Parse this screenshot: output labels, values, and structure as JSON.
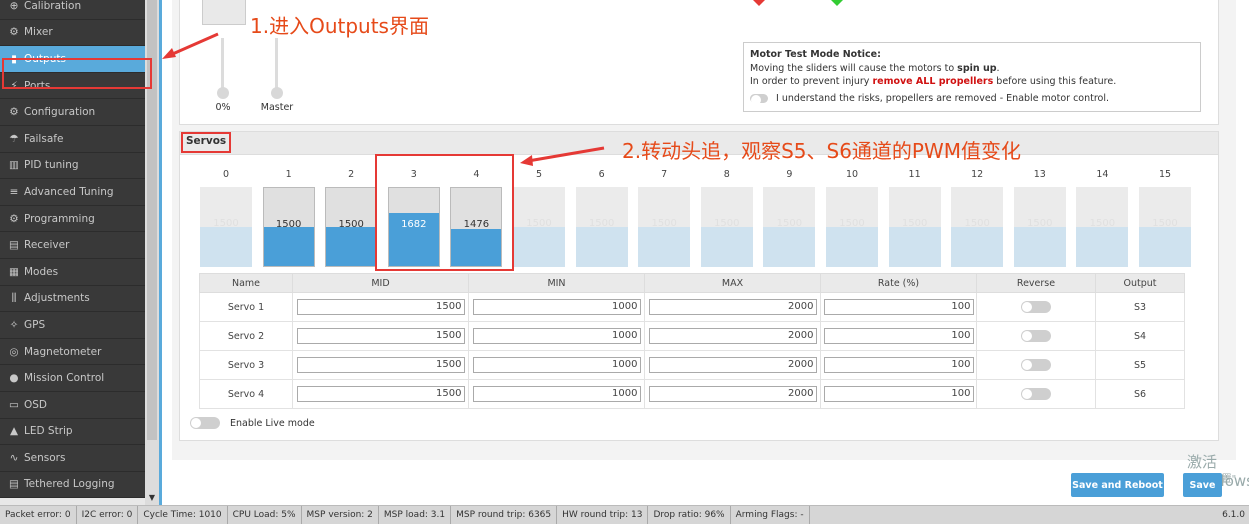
{
  "sidebar": {
    "items": [
      {
        "label": "Calibration",
        "icon": "crosshair-icon"
      },
      {
        "label": "Mixer",
        "icon": "mixer-icon"
      },
      {
        "label": "Outputs",
        "icon": "bottle-icon"
      },
      {
        "label": "Ports",
        "icon": "plug-icon"
      },
      {
        "label": "Configuration",
        "icon": "gear-icon"
      },
      {
        "label": "Failsafe",
        "icon": "parachute-icon"
      },
      {
        "label": "PID tuning",
        "icon": "chart-icon"
      },
      {
        "label": "Advanced Tuning",
        "icon": "tune-icon"
      },
      {
        "label": "Programming",
        "icon": "gear-icon"
      },
      {
        "label": "Receiver",
        "icon": "receiver-icon"
      },
      {
        "label": "Modes",
        "icon": "modes-icon"
      },
      {
        "label": "Adjustments",
        "icon": "sliders-icon"
      },
      {
        "label": "GPS",
        "icon": "satellite-icon"
      },
      {
        "label": "Magnetometer",
        "icon": "compass-icon"
      },
      {
        "label": "Mission Control",
        "icon": "map-pin-icon"
      },
      {
        "label": "OSD",
        "icon": "osd-icon"
      },
      {
        "label": "LED Strip",
        "icon": "led-icon"
      },
      {
        "label": "Sensors",
        "icon": "pulse-icon"
      },
      {
        "label": "Tethered Logging",
        "icon": "log-icon"
      }
    ],
    "active_index": 2
  },
  "motors": {
    "slider1_value": "0%",
    "master_label": "Master"
  },
  "notice": {
    "title": "Motor Test Mode Notice:",
    "line1_pre": "Moving the sliders will cause the motors to ",
    "line1_bold": "spin up",
    "line1_post": ".",
    "line2_pre": "In order to prevent injury ",
    "line2_red": "remove ALL propellers",
    "line2_post": " before using this feature.",
    "enable_label": "I understand the risks, propellers are removed - Enable motor control."
  },
  "servos": {
    "title": "Servos",
    "channels": [
      {
        "label": "0",
        "value": "1500",
        "fraction": 0.5,
        "active": false
      },
      {
        "label": "1",
        "value": "1500",
        "fraction": 0.5,
        "active": true
      },
      {
        "label": "2",
        "value": "1500",
        "fraction": 0.5,
        "active": true
      },
      {
        "label": "3",
        "value": "1682",
        "fraction": 0.68,
        "active": true
      },
      {
        "label": "4",
        "value": "1476",
        "fraction": 0.48,
        "active": true
      },
      {
        "label": "5",
        "value": "1500",
        "fraction": 0.5,
        "active": false
      },
      {
        "label": "6",
        "value": "1500",
        "fraction": 0.5,
        "active": false
      },
      {
        "label": "7",
        "value": "1500",
        "fraction": 0.5,
        "active": false
      },
      {
        "label": "8",
        "value": "1500",
        "fraction": 0.5,
        "active": false
      },
      {
        "label": "9",
        "value": "1500",
        "fraction": 0.5,
        "active": false
      },
      {
        "label": "10",
        "value": "1500",
        "fraction": 0.5,
        "active": false
      },
      {
        "label": "11",
        "value": "1500",
        "fraction": 0.5,
        "active": false
      },
      {
        "label": "12",
        "value": "1500",
        "fraction": 0.5,
        "active": false
      },
      {
        "label": "13",
        "value": "1500",
        "fraction": 0.5,
        "active": false
      },
      {
        "label": "14",
        "value": "1500",
        "fraction": 0.5,
        "active": false
      },
      {
        "label": "15",
        "value": "1500",
        "fraction": 0.5,
        "active": false
      }
    ],
    "table": {
      "headers": [
        "Name",
        "MID",
        "MIN",
        "MAX",
        "Rate (%)",
        "Reverse",
        "Output"
      ],
      "rows": [
        {
          "name": "Servo 1",
          "mid": "1500",
          "min": "1000",
          "max": "2000",
          "rate": "100",
          "output": "S3"
        },
        {
          "name": "Servo 2",
          "mid": "1500",
          "min": "1000",
          "max": "2000",
          "rate": "100",
          "output": "S4"
        },
        {
          "name": "Servo 3",
          "mid": "1500",
          "min": "1000",
          "max": "2000",
          "rate": "100",
          "output": "S5"
        },
        {
          "name": "Servo 4",
          "mid": "1500",
          "min": "1000",
          "max": "2000",
          "rate": "100",
          "output": "S6"
        }
      ]
    },
    "live_mode_label": "Enable Live mode"
  },
  "buttons": {
    "save_reboot": "Save and Reboot",
    "save": "Save"
  },
  "watermark": {
    "line1": "激活 Windows",
    "line2": "转到\"设置\""
  },
  "status_bar": {
    "cells": [
      "Packet error: 0",
      "I2C error: 0",
      "Cycle Time: 1010",
      "CPU Load: 5%",
      "MSP version: 2",
      "MSP load: 3.1",
      "MSP round trip: 6365",
      "HW round trip: 13",
      "Drop ratio: 96%",
      "Arming Flags: -"
    ],
    "version": "6.1.0"
  },
  "annotations": {
    "step1": "1.进入Outputs界面",
    "step2": "2.转动头追，观察S5、S6通道的PWM值变化",
    "color": "#e64a19"
  },
  "colors": {
    "accent": "#59aadb",
    "bar_active": "#4a9fd8",
    "annotation_red": "#e53935"
  }
}
